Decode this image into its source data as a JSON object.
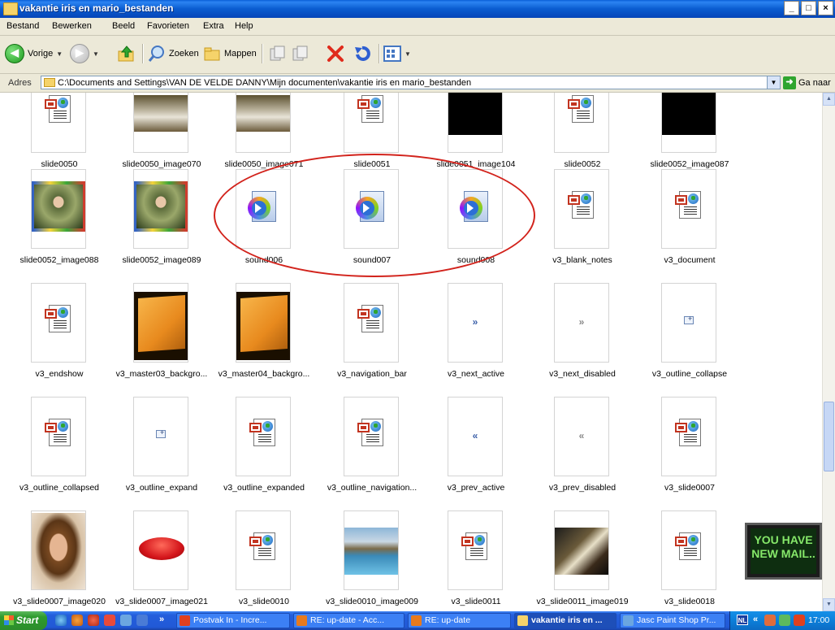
{
  "window": {
    "title": "vakantie iris en mario_bestanden",
    "buttons": [
      "_",
      "□",
      "×"
    ]
  },
  "menu": [
    "Bestand",
    "Bewerken",
    "Beeld",
    "Favorieten",
    "Extra",
    "Help"
  ],
  "toolbar": {
    "back": "Vorige",
    "search": "Zoeken",
    "folders": "Mappen"
  },
  "address": {
    "label": "Adres",
    "value": "C:\\Documents and Settings\\VAN DE VELDE DANNY\\Mijn documenten\\vakantie iris en mario_bestanden",
    "go": "Ga naar"
  },
  "files": [
    {
      "name": "slide0050",
      "kind": "page"
    },
    {
      "name": "slide0050_image070",
      "kind": "photo-bed"
    },
    {
      "name": "slide0050_image071",
      "kind": "photo-bed"
    },
    {
      "name": "slide0051",
      "kind": "page"
    },
    {
      "name": "slide0051_image104",
      "kind": "black"
    },
    {
      "name": "slide0052",
      "kind": "page"
    },
    {
      "name": "slide0052_image087",
      "kind": "black"
    },
    {
      "name": "slide0052_image088",
      "kind": "photo-framed"
    },
    {
      "name": "slide0052_image089",
      "kind": "photo-framed"
    },
    {
      "name": "sound006",
      "kind": "media"
    },
    {
      "name": "sound007",
      "kind": "media"
    },
    {
      "name": "sound008",
      "kind": "media"
    },
    {
      "name": "v3_blank_notes",
      "kind": "page"
    },
    {
      "name": "v3_document",
      "kind": "page"
    },
    {
      "name": "v3_endshow",
      "kind": "page"
    },
    {
      "name": "v3_master03_backgro...",
      "kind": "orange"
    },
    {
      "name": "v3_master04_backgro...",
      "kind": "orange"
    },
    {
      "name": "v3_navigation_bar",
      "kind": "page"
    },
    {
      "name": "v3_next_active",
      "kind": "glyph",
      "glyph": "»"
    },
    {
      "name": "v3_next_disabled",
      "kind": "glyph-gray",
      "glyph": "»"
    },
    {
      "name": "v3_outline_collapse",
      "kind": "outline"
    },
    {
      "name": "v3_outline_collapsed",
      "kind": "page"
    },
    {
      "name": "v3_outline_expand",
      "kind": "outline"
    },
    {
      "name": "v3_outline_expanded",
      "kind": "page"
    },
    {
      "name": "v3_outline_navigation...",
      "kind": "page"
    },
    {
      "name": "v3_prev_active",
      "kind": "glyph",
      "glyph": "«"
    },
    {
      "name": "v3_prev_disabled",
      "kind": "glyph-gray",
      "glyph": "«"
    },
    {
      "name": "v3_slide0007",
      "kind": "page"
    },
    {
      "name": "v3_slide0007_image020",
      "kind": "photo-woman"
    },
    {
      "name": "v3_slide0007_image021",
      "kind": "lips"
    },
    {
      "name": "v3_slide0010",
      "kind": "page"
    },
    {
      "name": "v3_slide0010_image009",
      "kind": "photo-pool"
    },
    {
      "name": "v3_slide0011",
      "kind": "page"
    },
    {
      "name": "v3_slide0011_image019",
      "kind": "photo-street"
    },
    {
      "name": "v3_slide0018",
      "kind": "page"
    }
  ],
  "mail_notifier": {
    "line1": "YOU HAVE",
    "line2": "NEW MAIL.."
  },
  "taskbar": {
    "start": "Start",
    "tasks": [
      {
        "label": "Postvak In - Incre...",
        "active": false,
        "color": "#E0401E"
      },
      {
        "label": "RE: up-date - Acc...",
        "active": false,
        "color": "#E77A1E"
      },
      {
        "label": "RE: up-date",
        "active": false,
        "color": "#E77A1E"
      },
      {
        "label": "vakantie iris en ...",
        "active": true,
        "color": "#F5D36A"
      },
      {
        "label": "Jasc Paint Shop Pr...",
        "active": false,
        "color": "#6BA6E0"
      }
    ],
    "lang": "NL",
    "clock": "17:00"
  }
}
